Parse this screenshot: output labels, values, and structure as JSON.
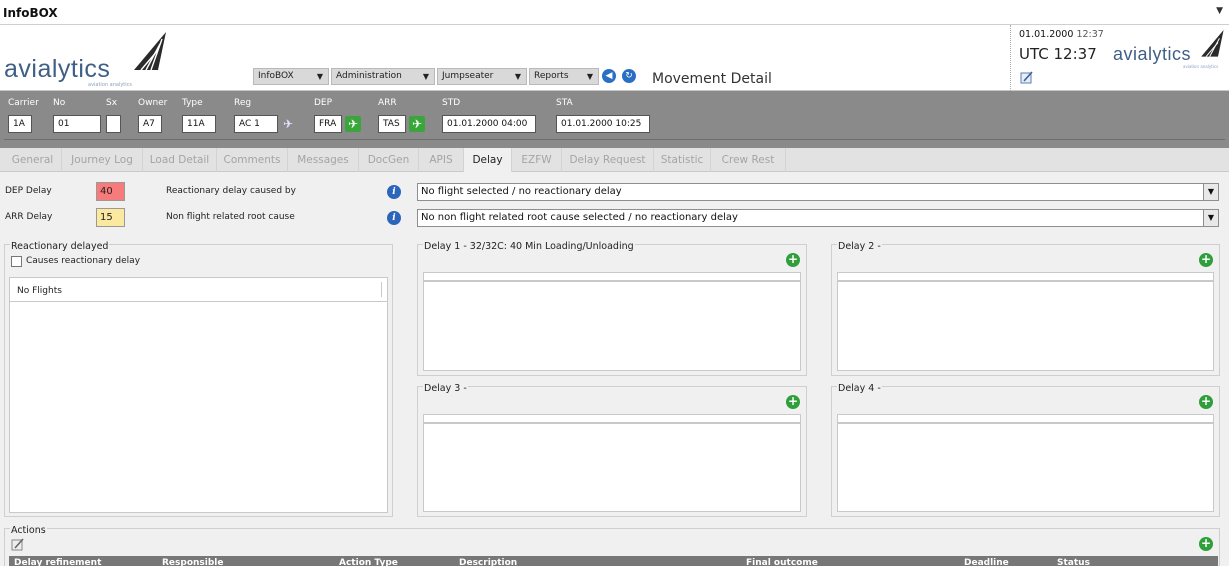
{
  "app": {
    "title": "InfoBOX"
  },
  "header": {
    "logo_text": "avialytics",
    "logo_sub": "aviation analytics",
    "menus": [
      {
        "label": "InfoBOX"
      },
      {
        "label": "Administration"
      },
      {
        "label": "Jumpseater"
      },
      {
        "label": "Reports"
      }
    ],
    "page_title": "Movement Detail",
    "datetime": "01.01.2000",
    "time_small": "12:37",
    "utc": "UTC 12:37"
  },
  "flight": {
    "labels": {
      "carrier": "Carrier",
      "no": "No",
      "sx": "Sx",
      "owner": "Owner",
      "type": "Type",
      "reg": "Reg",
      "dep": "DEP",
      "arr": "ARR",
      "std": "STD",
      "sta": "STA"
    },
    "values": {
      "carrier": "1A",
      "no": "01",
      "sx": "",
      "owner": "A7",
      "type": "11A",
      "reg": "AC 1",
      "dep": "FRA",
      "arr": "TAS",
      "std": "01.01.2000 04:00",
      "sta": "01.01.2000 10:25"
    }
  },
  "tabs": [
    "General",
    "Journey Log",
    "Load Detail",
    "Comments",
    "Messages",
    "DocGen",
    "APIS",
    "Delay",
    "EZFW",
    "Delay Request",
    "Statistic",
    "Crew Rest"
  ],
  "delay": {
    "dep_label": "DEP Delay",
    "dep_value": "40",
    "arr_label": "ARR Delay",
    "arr_value": "15",
    "reactionary_label": "Reactionary delay caused by",
    "reactionary_value": "No flight selected / no reactionary delay",
    "root_label": "Non flight related root cause",
    "root_value": "No non flight related root cause selected / no reactionary delay",
    "colors": {
      "dep": "#f77b7b",
      "arr": "#fbe9a0"
    }
  },
  "reactionary_panel": {
    "title": "Reactionary delayed",
    "checkbox_label": "Causes reactionary delay",
    "list_header": "No Flights"
  },
  "delay_panels": [
    {
      "title": "Delay 1 - 32/32C: 40 Min Loading/Unloading"
    },
    {
      "title": "Delay 2 -"
    },
    {
      "title": "Delay 3 -"
    },
    {
      "title": "Delay 4 -"
    }
  ],
  "actions": {
    "title": "Actions",
    "columns": [
      "Delay refinement",
      "Responsible",
      "Action Type",
      "Description",
      "Final outcome",
      "Deadline",
      "Status"
    ]
  }
}
